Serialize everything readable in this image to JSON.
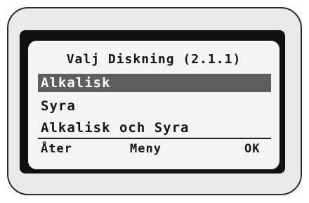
{
  "display": {
    "title": "Valj Diskning (2.1.1)",
    "menu_items": [
      {
        "label": "Alkalisk",
        "selected": true
      },
      {
        "label": "Syra",
        "selected": false
      },
      {
        "label": "Alkalisk och Syra",
        "selected": false
      }
    ],
    "softkeys": {
      "left": "Åter",
      "middle": "Meny",
      "right": "OK"
    }
  },
  "colors": {
    "device_body": "#e9e9e9",
    "bezel": "#111111",
    "screen_background": "#f4f4f4",
    "selection_highlight": "#5f5f5f",
    "text": "#151515"
  }
}
